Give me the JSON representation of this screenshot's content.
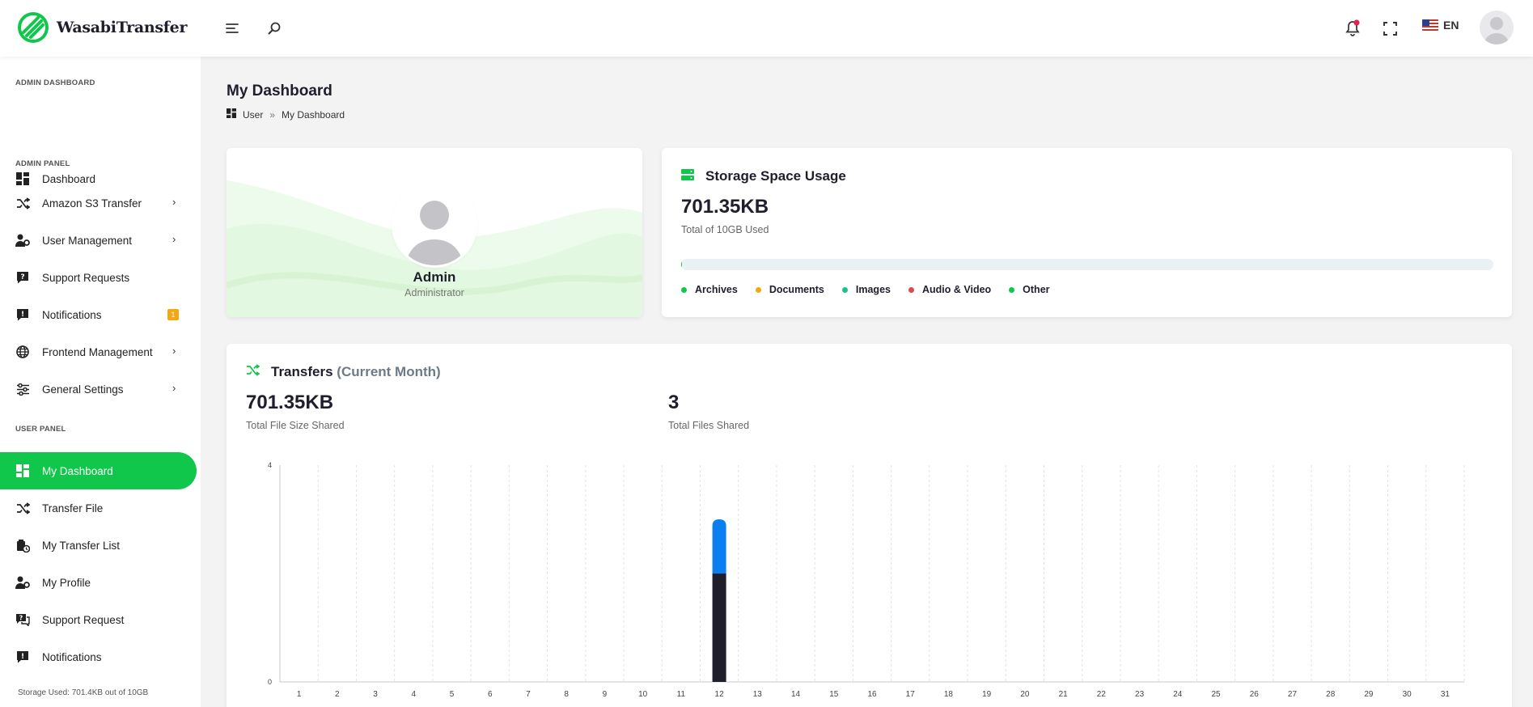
{
  "app": {
    "name": "WasabiTransfer",
    "lang": "EN"
  },
  "sidebar": {
    "sections": [
      "ADMIN DASHBOARD",
      "ADMIN PANEL",
      "USER PANEL"
    ],
    "items": [
      {
        "label": "Dashboard",
        "icon": "dashboard-icon"
      },
      {
        "label": "Amazon S3 Transfer",
        "icon": "shuffle-icon",
        "chevron": true
      },
      {
        "label": "User Management",
        "icon": "user-cog-icon",
        "chevron": true
      },
      {
        "label": "Support Requests",
        "icon": "question-bubble-icon"
      },
      {
        "label": "Notifications",
        "icon": "alert-bubble-icon",
        "badge": "1"
      },
      {
        "label": "Frontend Management",
        "icon": "globe-icon",
        "chevron": true
      },
      {
        "label": "General Settings",
        "icon": "sliders-icon",
        "chevron": true
      },
      {
        "label": "My Dashboard",
        "icon": "dashboard-icon",
        "active": true
      },
      {
        "label": "Transfer File",
        "icon": "shuffle-icon"
      },
      {
        "label": "My Transfer List",
        "icon": "transfer-list-icon"
      },
      {
        "label": "My Profile",
        "icon": "user-cog-icon"
      },
      {
        "label": "Support Request",
        "icon": "question-bubble-icon"
      },
      {
        "label": "Notifications",
        "icon": "alert-bubble-icon"
      }
    ],
    "storage_used": "Storage Used: 701.4KB out of 10GB"
  },
  "page": {
    "title": "My Dashboard",
    "breadcrumb": [
      "User",
      "»",
      "My Dashboard"
    ]
  },
  "profile": {
    "name": "Admin",
    "role": "Administrator"
  },
  "storage": {
    "title": "Storage Space Usage",
    "used": "701.35KB",
    "total_text": "Total of 10GB Used",
    "used_fraction": 0.0001,
    "legend": [
      {
        "label": "Archives",
        "color": "#10c74b"
      },
      {
        "label": "Documents",
        "color": "#f3a712"
      },
      {
        "label": "Images",
        "color": "#1fbf87"
      },
      {
        "label": "Audio & Video",
        "color": "#e0474c"
      },
      {
        "label": "Other",
        "color": "#10c74b"
      }
    ]
  },
  "transfers": {
    "title": "Transfers",
    "title_suffix": "(Current Month)",
    "size": "701.35KB",
    "size_label": "Total File Size Shared",
    "files": "3",
    "files_label": "Total Files Shared"
  },
  "colors": {
    "accent": "#10c74b",
    "bar_dark": "#1e1e2d",
    "bar_blue": "#0b7ff0"
  },
  "chart_data": {
    "type": "bar",
    "stacked": true,
    "categories": [
      "1",
      "2",
      "3",
      "4",
      "5",
      "6",
      "7",
      "8",
      "9",
      "10",
      "11",
      "12",
      "13",
      "14",
      "15",
      "16",
      "17",
      "18",
      "19",
      "20",
      "21",
      "22",
      "23",
      "24",
      "25",
      "26",
      "27",
      "28",
      "29",
      "30",
      "31"
    ],
    "series": [
      {
        "values": [
          0,
          0,
          0,
          0,
          0,
          0,
          0,
          0,
          0,
          0,
          0,
          2,
          0,
          0,
          0,
          0,
          0,
          0,
          0,
          0,
          0,
          0,
          0,
          0,
          0,
          0,
          0,
          0,
          0,
          0,
          0
        ],
        "color": "#1e1e2d"
      },
      {
        "values": [
          0,
          0,
          0,
          0,
          0,
          0,
          0,
          0,
          0,
          0,
          0,
          1,
          0,
          0,
          0,
          0,
          0,
          0,
          0,
          0,
          0,
          0,
          0,
          0,
          0,
          0,
          0,
          0,
          0,
          0,
          0
        ],
        "color": "#0b7ff0"
      }
    ],
    "ylim": [
      0,
      4
    ],
    "yticks": [
      "0",
      "4"
    ],
    "grid": true
  }
}
